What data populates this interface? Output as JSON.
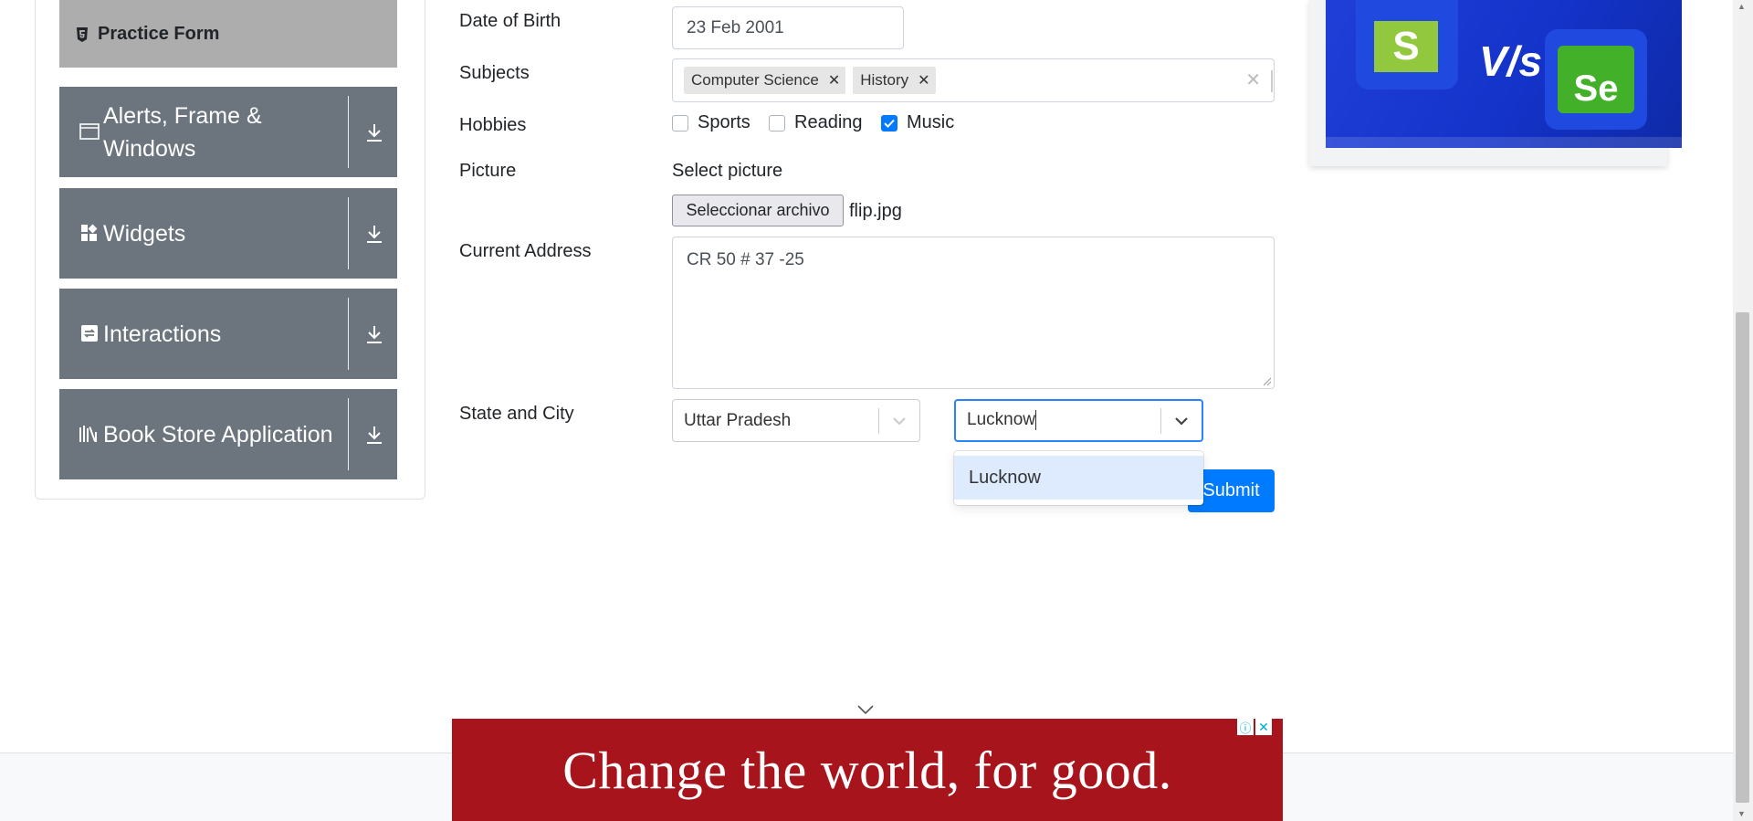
{
  "sidebar": {
    "active_item": "Practice Form",
    "groups": [
      {
        "label": "Alerts, Frame & Windows",
        "icon": "window-icon"
      },
      {
        "label": "Widgets",
        "icon": "widgets-icon"
      },
      {
        "label": "Interactions",
        "icon": "interactions-icon"
      },
      {
        "label": "Book Store Application",
        "icon": "books-icon"
      }
    ]
  },
  "form": {
    "dob_label": "Date of Birth",
    "dob_value": "23 Feb 2001",
    "subjects_label": "Subjects",
    "subjects": [
      "Computer Science",
      "History"
    ],
    "hobbies_label": "Hobbies",
    "hobbies": [
      {
        "label": "Sports",
        "checked": false
      },
      {
        "label": "Reading",
        "checked": false
      },
      {
        "label": "Music",
        "checked": true
      }
    ],
    "picture_label": "Picture",
    "picture_prompt": "Select picture",
    "file_button": "Seleccionar archivo",
    "file_name": "flip.jpg",
    "address_label": "Current Address",
    "address_value": "CR 50 # 37 -25",
    "state_city_label": "State and City",
    "state_value": "Uttar Pradesh",
    "city_value": "Lucknow",
    "city_options": [
      "Lucknow"
    ],
    "submit_label": "Submit"
  },
  "ads": {
    "bottom_text": "Change the world, for good.",
    "top_banner_mid": "V/s",
    "top_banner_s": "S",
    "top_banner_se": "Se"
  },
  "colors": {
    "accent": "#007bff",
    "sidebar_group": "#6c757d",
    "sidebar_active": "#adadad",
    "ad_red": "#a8141b"
  }
}
